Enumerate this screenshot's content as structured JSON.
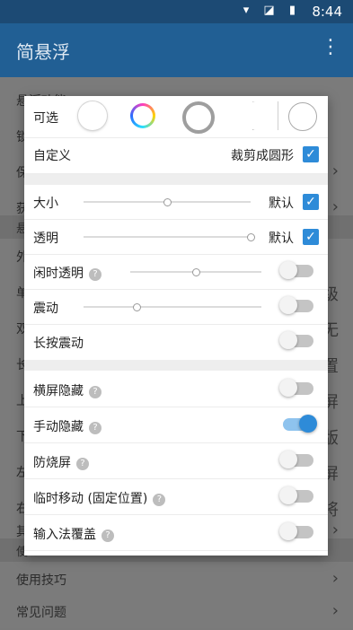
{
  "status": {
    "time": "8:44",
    "icons": "▾ ◪ ▮"
  },
  "app": {
    "title": "简悬浮",
    "menu_icon": "⋮"
  },
  "background": {
    "rows": [
      {
        "label": "悬浮功能"
      },
      {
        "label": "锁"
      },
      {
        "label": "保"
      },
      {
        "label": "获"
      },
      {
        "label": "悬"
      },
      {
        "label": "外"
      },
      {
        "label": "单"
      },
      {
        "label": "双"
      },
      {
        "label": "长"
      },
      {
        "label": "上"
      },
      {
        "label": "下"
      },
      {
        "label": "左"
      },
      {
        "label": "右"
      },
      {
        "label": "其"
      }
    ],
    "section_label": "使",
    "bottom_rows": [
      {
        "label": "使用技巧"
      },
      {
        "label": "常见问题"
      }
    ],
    "right_fragments": [
      "级",
      "无",
      "置",
      "屏",
      "版",
      "屏",
      "将"
    ]
  },
  "dialog": {
    "optional_label": "可选",
    "custom_label": "自定义",
    "crop_label": "裁剪成圆形",
    "size": {
      "label": "大小",
      "default_label": "默认",
      "value": 0.5
    },
    "opacity": {
      "label": "透明",
      "default_label": "默认",
      "value": 1.0
    },
    "idle_opacity": {
      "label": "闲时透明",
      "value": 0.5
    },
    "vibrate": {
      "label": "震动",
      "value": 0.3
    },
    "long_press_vibrate": {
      "label": "长按震动"
    },
    "landscape_hide": {
      "label": "横屏隐藏"
    },
    "manual_hide": {
      "label": "手动隐藏"
    },
    "burn_in": {
      "label": "防烧屏"
    },
    "temp_move": {
      "label": "临时移动 (固定位置)"
    },
    "ime_cover": {
      "label": "输入法覆盖"
    },
    "help_icon": "?",
    "check_icon": "✓"
  }
}
